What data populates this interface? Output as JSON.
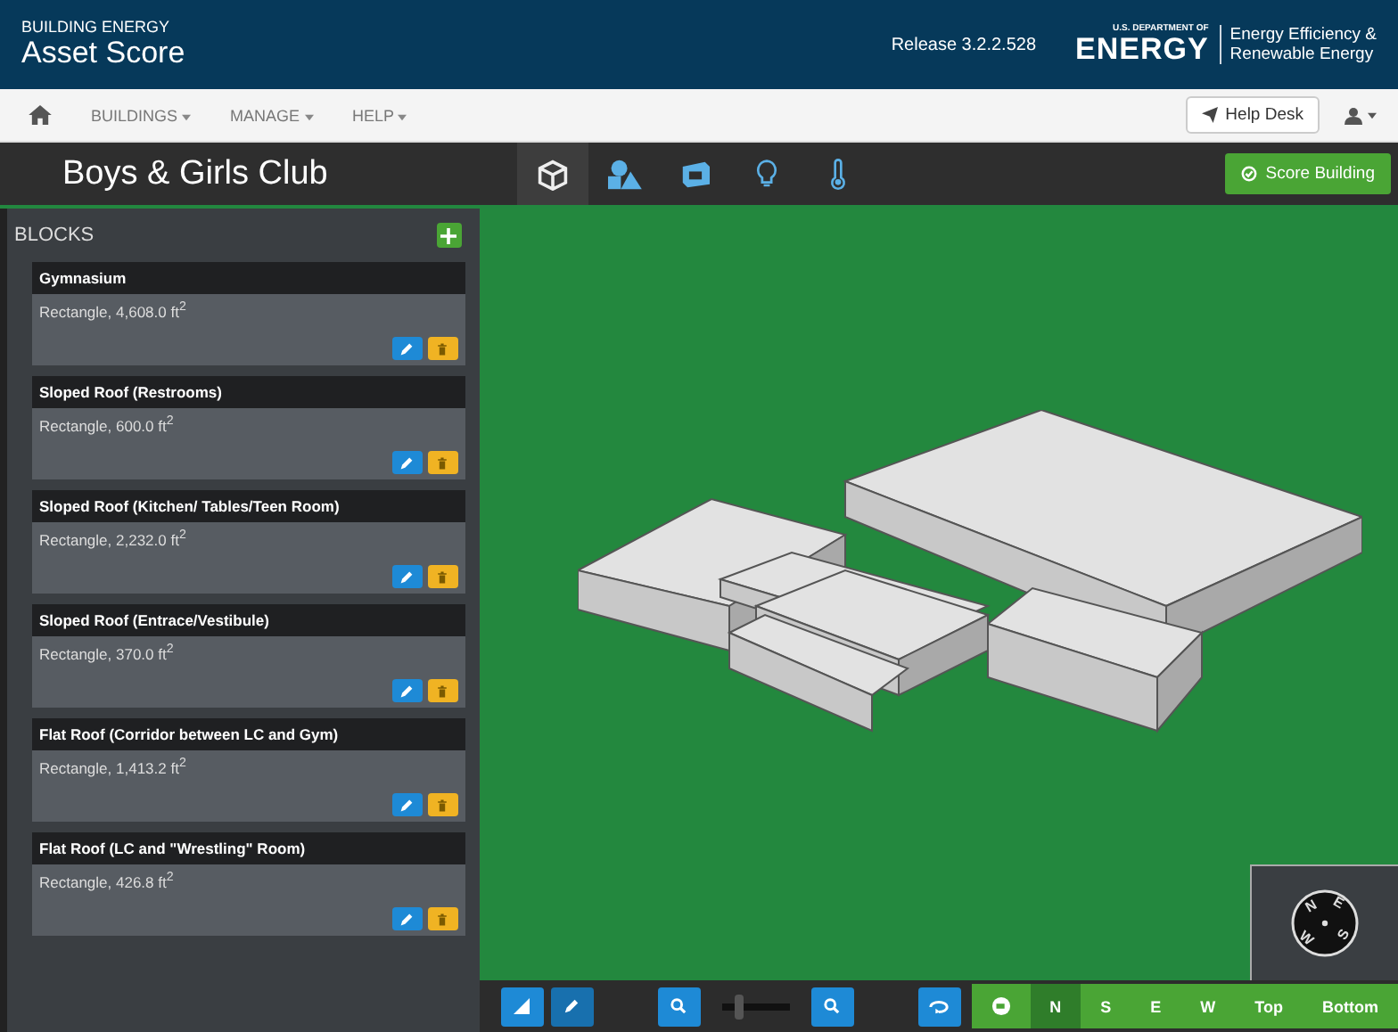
{
  "header": {
    "brand_small": "BUILDING ENERGY",
    "brand": "Asset Score",
    "release": "Release 3.2.2.528",
    "doe_small": "U.S. DEPARTMENT OF",
    "doe": "ENERGY",
    "office": [
      "Energy Efficiency &",
      "Renewable Energy"
    ]
  },
  "nav": {
    "items": [
      "BUILDINGS",
      "MANAGE",
      "HELP"
    ],
    "help_desk": "Help Desk"
  },
  "building": {
    "title": "Boys & Girls Club",
    "score_button": "Score Building"
  },
  "tabs": [
    {
      "kind": "cube",
      "selected": true
    },
    {
      "kind": "shapes",
      "selected": false
    },
    {
      "kind": "panel",
      "selected": false
    },
    {
      "kind": "bulb",
      "selected": false
    },
    {
      "kind": "thermometer",
      "selected": false
    }
  ],
  "blocks": {
    "title": "BLOCKS",
    "items": [
      {
        "name": "Gymnasium",
        "shape": "Rectangle, 4,608.0 ft$^{2}$"
      },
      {
        "name": "Sloped Roof (Restrooms)",
        "shape": "Rectangle, 600.0 ft$^{2}$"
      },
      {
        "name": "Sloped Roof (Kitchen/ Tables/Teen Room)",
        "shape": "Rectangle, 2,232.0 ft$^{2}$"
      },
      {
        "name": "Sloped Roof (Entrace/Vestibule)",
        "shape": "Rectangle, 370.0 ft$^{2}$"
      },
      {
        "name": "Flat Roof (Corridor between LC and Gym)",
        "shape": "Rectangle, 1,413.2 ft$^{2}$"
      },
      {
        "name": "Flat Roof (LC and \"Wrestling\" Room)",
        "shape": "Rectangle, 426.8 ft$^{2}$"
      }
    ]
  },
  "compass": {
    "letters": [
      "N",
      "E",
      "S",
      "W"
    ]
  },
  "toolbar": {
    "zoom": {
      "level": 0.2
    },
    "views": [
      {
        "label": "N",
        "selected": true
      },
      {
        "label": "S",
        "selected": false
      },
      {
        "label": "E",
        "selected": false
      },
      {
        "label": "W",
        "selected": false
      },
      {
        "label": "Top",
        "selected": false
      },
      {
        "label": "Bottom",
        "selected": false
      }
    ]
  }
}
